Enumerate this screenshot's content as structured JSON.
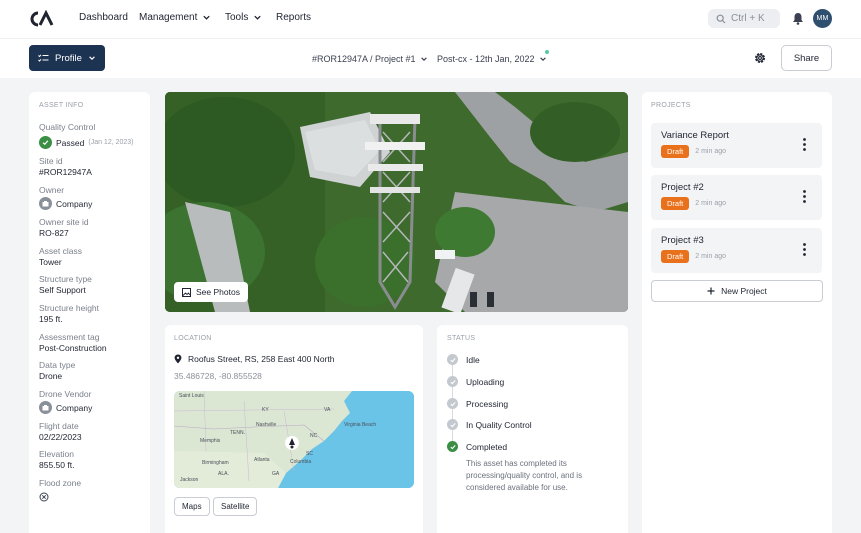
{
  "nav": {
    "items": [
      {
        "label": "Dashboard",
        "dropdown": false
      },
      {
        "label": "Management",
        "dropdown": true
      },
      {
        "label": "Tools",
        "dropdown": true
      },
      {
        "label": "Reports",
        "dropdown": false
      }
    ],
    "search_placeholder": "Ctrl + K",
    "avatar_initials": "MM",
    "icons": {
      "logo": "ca-logo",
      "search": "search-icon",
      "bell": "bell-icon"
    }
  },
  "subheader": {
    "profile_label": "Profile",
    "breadcrumb_site": "#ROR12947A / Project #1",
    "breadcrumb_phase": "Post-cx - 12th Jan, 2022",
    "share_label": "Share"
  },
  "asset_info": {
    "heading": "ASSET INFO",
    "qc_label": "Quality Control",
    "qc_status": "Passed",
    "qc_date": "(Jan 12, 2023)",
    "fields": [
      {
        "label": "Site id",
        "value": "#ROR12947A"
      },
      {
        "label": "Owner",
        "value": "Company"
      },
      {
        "label": "Owner site id",
        "value": "RO-827"
      },
      {
        "label": "Asset class",
        "value": "Tower"
      },
      {
        "label": "Structure type",
        "value": "Self Support"
      },
      {
        "label": "Structure height",
        "value": "195 ft."
      },
      {
        "label": "Assessment tag",
        "value": "Post-Construction"
      },
      {
        "label": "Data type",
        "value": "Drone"
      },
      {
        "label": "Drone Vendor",
        "value": "Company"
      },
      {
        "label": "Flight date",
        "value": "02/22/2023"
      },
      {
        "label": "Elevation",
        "value": "855.50 ft."
      },
      {
        "label": "Flood zone",
        "value": ""
      }
    ]
  },
  "photo": {
    "see_photos_label": "See Photos"
  },
  "location": {
    "heading": "LOCATION",
    "address": "Roofus Street, RS, 258 East 400 North",
    "coords": "35.486728, -80.855528",
    "map_labels": [
      "Saint Louis",
      "KY",
      "VA",
      "Virginia Beach",
      "TENN.",
      "Memphis",
      "Nashville",
      "NC",
      "SC",
      "Birmingham",
      "Atlanta",
      "Columbia",
      "ALA.",
      "GA",
      "Jackson"
    ],
    "maps_label": "Maps",
    "satellite_label": "Satellite"
  },
  "status": {
    "heading": "STATUS",
    "steps": [
      {
        "label": "Idle",
        "done": false
      },
      {
        "label": "Uploading",
        "done": false
      },
      {
        "label": "Processing",
        "done": false
      },
      {
        "label": "In Quality Control",
        "done": false
      },
      {
        "label": "Completed",
        "done": true
      }
    ],
    "description": "This asset has completed its processing/quality control, and is considered available for use."
  },
  "projects": {
    "heading": "PROJECTS",
    "items": [
      {
        "title": "Variance Report",
        "badge": "Draft",
        "time": "2 min ago"
      },
      {
        "title": "Project #2",
        "badge": "Draft",
        "time": "2 min ago"
      },
      {
        "title": "Project #3",
        "badge": "Draft",
        "time": "2 min ago"
      }
    ],
    "new_label": "New Project"
  },
  "colors": {
    "navy": "#1d3352",
    "draft": "#e9711c",
    "success": "#3a8f45"
  }
}
